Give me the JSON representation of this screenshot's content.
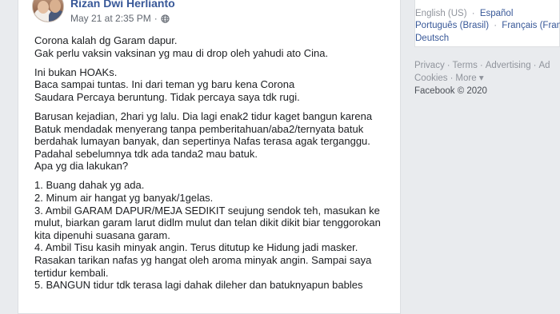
{
  "post": {
    "author": "Rizan Dwi Herlianto",
    "timestamp": "May 21 at 2:35 PM",
    "separator": "·",
    "privacy_icon": "globe-icon",
    "paragraphs": [
      [
        "Corona kalah dg Garam dapur.",
        "Gak perlu vaksin vaksinan yg mau di drop oleh yahudi ato Cina."
      ],
      [
        "Ini bukan HOAKs.",
        "Baca sampai tuntas. Ini dari teman yg baru kena Corona",
        "Saudara Percaya beruntung. Tidak percaya saya tdk rugi."
      ],
      [
        "Barusan kejadian, 2hari yg lalu. Dia lagi enak2 tidur kaget bangun karena",
        "Batuk mendadak menyerang tanpa pemberitahuan/aba2/ternyata batuk",
        "berdahak lumayan banyak, dan sepertinya Nafas terasa agak terganggu.",
        "Padahal sebelumnya tdk ada tanda2 mau batuk.",
        "Apa yg dia lakukan?"
      ],
      [
        "1. Buang dahak yg ada.",
        "2. Minum air hangat yg banyak/1gelas.",
        "3. Ambil GARAM DAPUR/MEJA SEDIKIT seujung sendok teh, masukan ke",
        "mulut, biarkan garam larut didlm mulut dan telan dikit dikit biar tenggorokan",
        "kita dipenuhi suasana garam.",
        "4. Ambil Tisu kasih minyak angin. Terus ditutup ke Hidung jadi masker.",
        "Rasakan tarikan nafas yg hangat oleh aroma minyak angin. Sampai saya",
        "tertidur kembali.",
        "5. BANGUN tidur tdk terasa lagi dahak dileher dan batuknyapun bables"
      ]
    ]
  },
  "sidebar": {
    "languages": {
      "current": "English (US)",
      "links": [
        "Español",
        "Português (Brasil)",
        "Français (France)",
        "Deutsch"
      ],
      "separator": "·"
    },
    "footer": {
      "links_row1": [
        "Privacy",
        "Terms",
        "Advertising",
        "Ad"
      ],
      "links_row2": [
        "Cookies",
        "More"
      ],
      "more_caret": "▾",
      "separator": "·",
      "copyright": "Facebook © 2020"
    }
  }
}
